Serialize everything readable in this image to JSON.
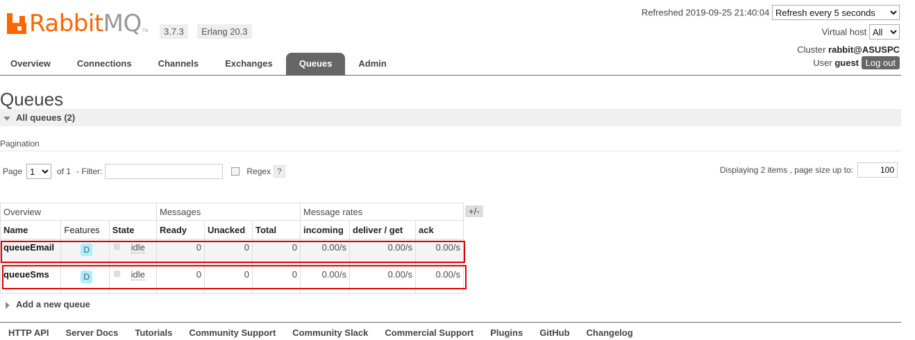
{
  "header": {
    "logo_text_rabbit": "Rabbit",
    "logo_text_mq": "MQ",
    "logo_tm": "TM",
    "version": "3.7.3",
    "erlang": "Erlang 20.3",
    "refreshed_label": "Refreshed",
    "refreshed_time": "2019-09-25 21:40:04",
    "refresh_option": "Refresh every 5 seconds",
    "virtual_host_label": "Virtual host",
    "virtual_host_value": "All",
    "cluster_label": "Cluster",
    "cluster_name": "rabbit@ASUSPC",
    "user_label": "User",
    "user_name": "guest",
    "logout_label": "Log out"
  },
  "nav": {
    "overview": "Overview",
    "connections": "Connections",
    "channels": "Channels",
    "exchanges": "Exchanges",
    "queues": "Queues",
    "admin": "Admin"
  },
  "page_title": "Queues",
  "section_title": "All queues (2)",
  "pagination": {
    "label": "Pagination",
    "page_label": "Page",
    "page_value": "1",
    "of_label": "of 1",
    "filter_label": "- Filter:",
    "filter_value": "",
    "regex_label": "Regex",
    "help": "?",
    "displaying": "Displaying 2 items , page size up to:",
    "page_size": "100"
  },
  "table": {
    "groups": {
      "overview": "Overview",
      "messages": "Messages",
      "rates": "Message rates"
    },
    "plus_minus": "+/-",
    "columns": {
      "name": "Name",
      "features": "Features",
      "state": "State",
      "ready": "Ready",
      "unacked": "Unacked",
      "total": "Total",
      "incoming": "incoming",
      "deliver": "deliver / get",
      "ack": "ack"
    },
    "rows": [
      {
        "name": "queueEmail",
        "feature": "D",
        "state": "idle",
        "ready": "0",
        "unacked": "0",
        "total": "0",
        "incoming": "0.00/s",
        "deliver": "0.00/s",
        "ack": "0.00/s"
      },
      {
        "name": "queueSms",
        "feature": "D",
        "state": "idle",
        "ready": "0",
        "unacked": "0",
        "total": "0",
        "incoming": "0.00/s",
        "deliver": "0.00/s",
        "ack": "0.00/s"
      }
    ]
  },
  "add_queue": "Add a new queue",
  "footer": [
    "HTTP API",
    "Server Docs",
    "Tutorials",
    "Community Support",
    "Community Slack",
    "Commercial Support",
    "Plugins",
    "GitHub",
    "Changelog"
  ],
  "colors": {
    "brand": "#ff6600",
    "highlight": "#dd0000",
    "active_tab": "#666666"
  }
}
